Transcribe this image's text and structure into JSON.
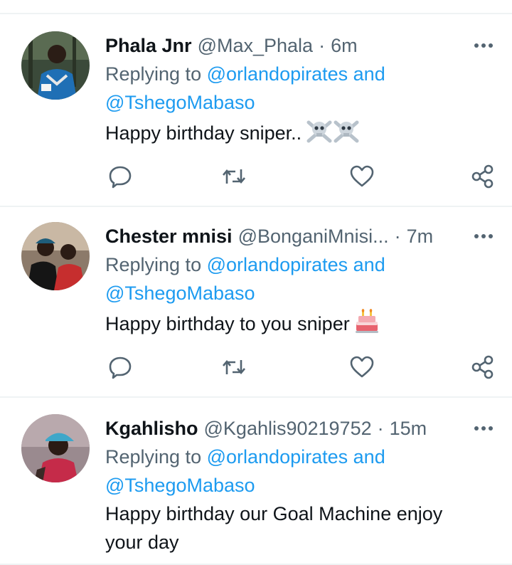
{
  "tweets": [
    {
      "name": "Phala Jnr",
      "handle": "@Max_Phala",
      "separator": "·",
      "time": "6m",
      "replying_prefix": "Replying to",
      "replying_mention_1": "@orlandopirates",
      "replying_and": "and",
      "replying_mention_2": "@TshegoMabaso",
      "text": "Happy birthday sniper..",
      "emoji": "skull-and-crossbones x2"
    },
    {
      "name": "Chester mnisi",
      "handle": "@BonganiMnisi...",
      "separator": "·",
      "time": "7m",
      "replying_prefix": "Replying to",
      "replying_mention_1": "@orlandopirates",
      "replying_and": "and",
      "replying_mention_2": "@TshegoMabaso",
      "text": "Happy birthday to you sniper",
      "emoji": "birthday-cake"
    },
    {
      "name": "Kgahlisho",
      "handle": "@Kgahlis90219752",
      "separator": "·",
      "time": "15m",
      "replying_prefix": "Replying to",
      "replying_mention_1": "@orlandopirates",
      "replying_and": "and",
      "replying_mention_2": "@TshegoMabaso",
      "text": "Happy birthday our Goal Machine enjoy your day"
    }
  ],
  "icons": {
    "more": "more-horizontal-icon",
    "reply": "reply-icon",
    "retweet": "retweet-icon",
    "like": "like-icon",
    "share": "share-icon"
  },
  "colors": {
    "mention": "#1d9bf0",
    "secondary_text": "#536471",
    "primary_text": "#0f1419",
    "divider": "#eff3f4"
  }
}
